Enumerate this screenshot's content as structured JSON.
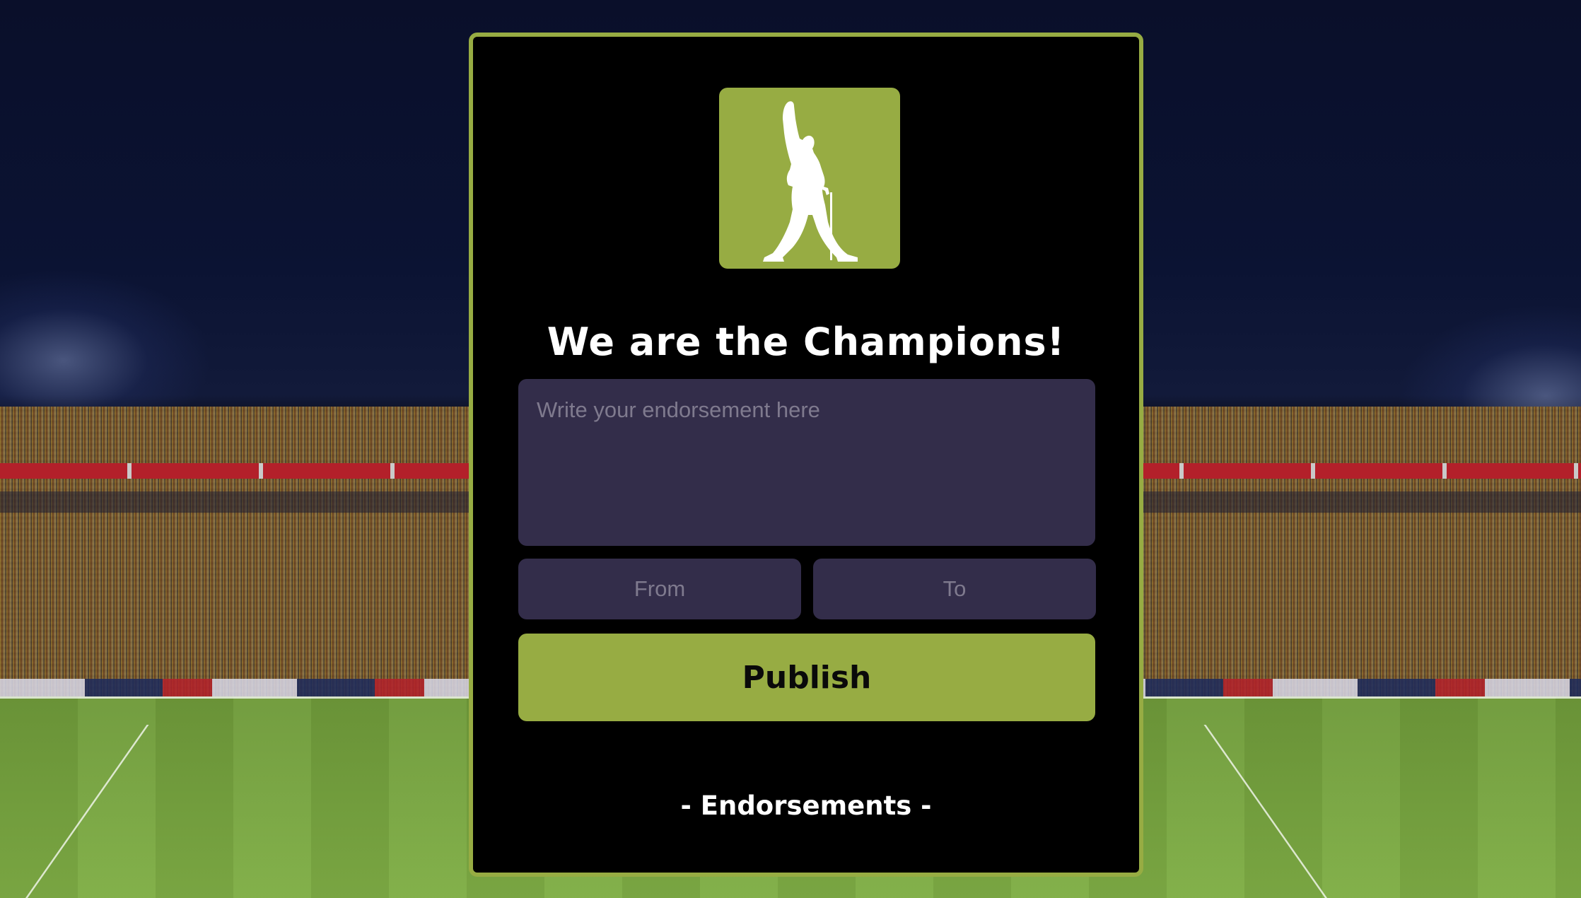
{
  "app": {
    "title": "We are the Champions!",
    "logo": "freddie-silhouette-icon"
  },
  "form": {
    "endorsement_placeholder": "Write your endorsement here",
    "endorsement_value": "",
    "from_placeholder": "From",
    "from_value": "",
    "to_placeholder": "To",
    "to_value": "",
    "publish_label": "Publish"
  },
  "endorsements": {
    "heading": "- Endorsements -",
    "items": []
  },
  "colors": {
    "accent": "#97ac43",
    "card_background": "#000000",
    "field_background": "#332d4a",
    "placeholder_text": "#7f7a8e",
    "title_text": "#ffffff"
  },
  "background": {
    "description_icon": "stadium-photo"
  }
}
